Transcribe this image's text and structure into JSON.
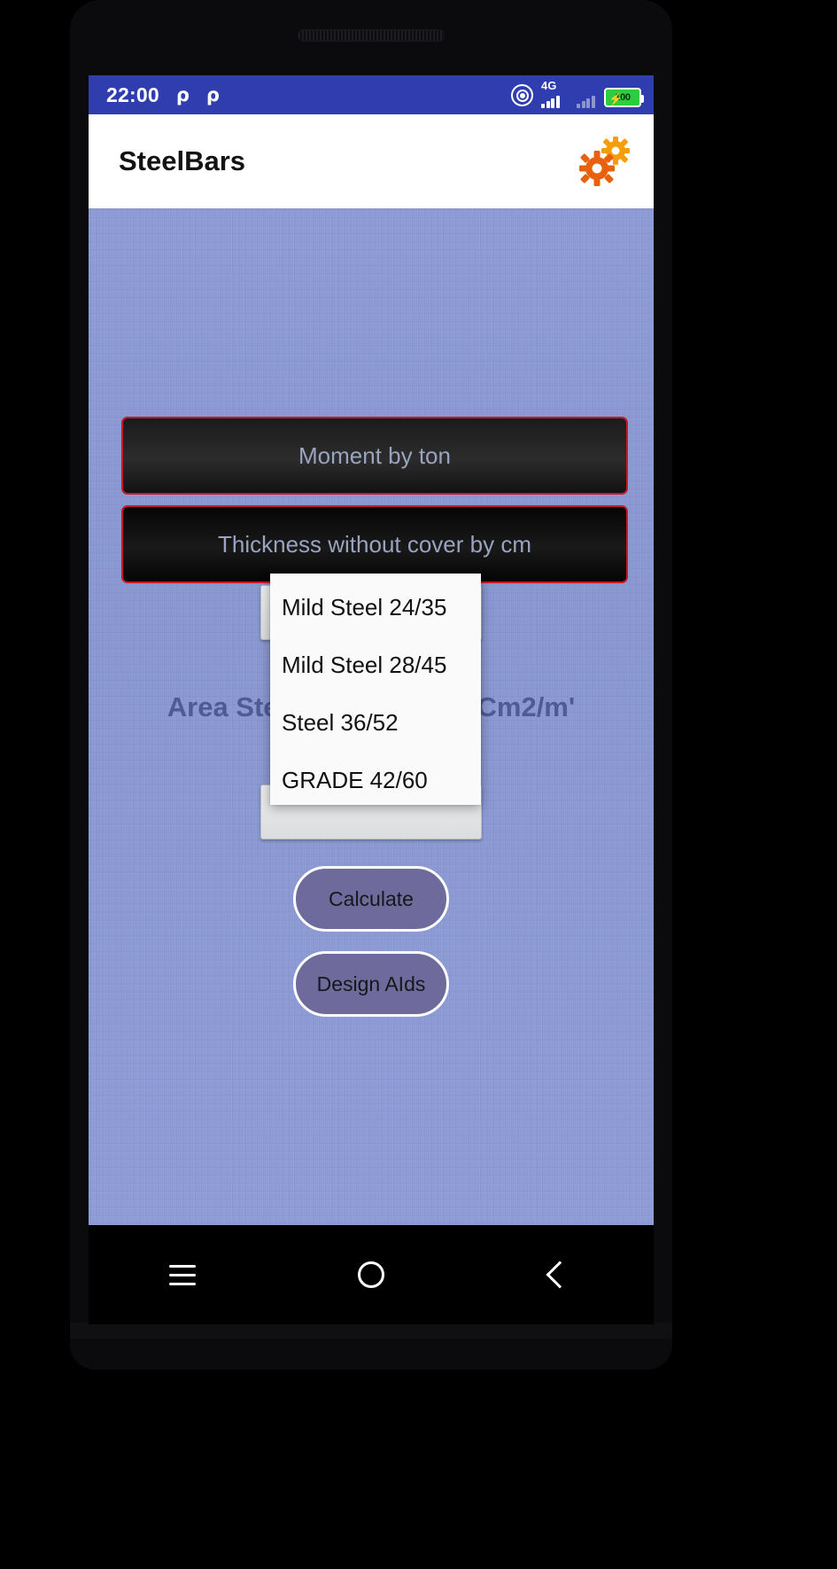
{
  "status_bar": {
    "clock": "22:00",
    "icon_p1": "p-icon",
    "icon_p2": "p-icon",
    "cast_icon": "cast-icon",
    "network_label": "4G",
    "battery_level": "100",
    "battery_charging_icon": "bolt-icon",
    "background_color": "#2f3dae"
  },
  "app_bar": {
    "title": "SteelBars",
    "settings_icon": "gears-icon",
    "background_color": "#ffffff"
  },
  "form": {
    "moment_field": {
      "value": "",
      "placeholder": "Moment by ton"
    },
    "thickness_field": {
      "value": "",
      "placeholder": "Thickness without cover by cm"
    },
    "field_border_color": "#c7192a"
  },
  "formula": {
    "label_left": "Area Steel=",
    "result_value": "",
    "unit": "Cm2/m'",
    "text_color": "#4e5c93"
  },
  "dropdown": {
    "open": true,
    "items": [
      {
        "label": "Mild Steel 24/35"
      },
      {
        "label": "Mild Steel 28/45"
      },
      {
        "label": "Steel 36/52"
      },
      {
        "label": "GRADE 42/60"
      }
    ]
  },
  "spinners": {
    "top_value": "",
    "bottom_value": ""
  },
  "buttons": {
    "calculate": "Calculate",
    "design_aids": "Design AIds",
    "fill_color": "#6e6a9b"
  },
  "nav_bar": {
    "recents_icon": "hamburger-icon",
    "home_icon": "circle-icon",
    "back_icon": "chevron-left-icon"
  }
}
